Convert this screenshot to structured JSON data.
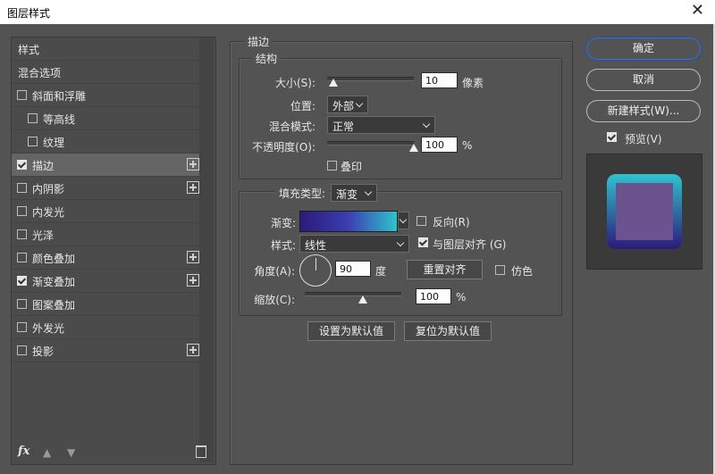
{
  "window": {
    "title": "图层样式",
    "close_icon": "close-icon"
  },
  "left_panel": {
    "items": [
      {
        "label": "样式",
        "checkbox": false,
        "checked": false,
        "plus": false,
        "indent": false,
        "selected": false
      },
      {
        "label": "混合选项",
        "checkbox": false,
        "checked": false,
        "plus": false,
        "indent": false,
        "selected": false
      },
      {
        "label": "斜面和浮雕",
        "checkbox": true,
        "checked": false,
        "plus": false,
        "indent": false,
        "selected": false
      },
      {
        "label": "等高线",
        "checkbox": true,
        "checked": false,
        "plus": false,
        "indent": true,
        "selected": false
      },
      {
        "label": "纹理",
        "checkbox": true,
        "checked": false,
        "plus": false,
        "indent": true,
        "selected": false
      },
      {
        "label": "描边",
        "checkbox": true,
        "checked": true,
        "plus": true,
        "indent": false,
        "selected": true
      },
      {
        "label": "内阴影",
        "checkbox": true,
        "checked": false,
        "plus": true,
        "indent": false,
        "selected": false
      },
      {
        "label": "内发光",
        "checkbox": true,
        "checked": false,
        "plus": false,
        "indent": false,
        "selected": false
      },
      {
        "label": "光泽",
        "checkbox": true,
        "checked": false,
        "plus": false,
        "indent": false,
        "selected": false
      },
      {
        "label": "颜色叠加",
        "checkbox": true,
        "checked": false,
        "plus": true,
        "indent": false,
        "selected": false
      },
      {
        "label": "渐变叠加",
        "checkbox": true,
        "checked": true,
        "plus": true,
        "indent": false,
        "selected": false
      },
      {
        "label": "图案叠加",
        "checkbox": true,
        "checked": false,
        "plus": false,
        "indent": false,
        "selected": false
      },
      {
        "label": "外发光",
        "checkbox": true,
        "checked": false,
        "plus": false,
        "indent": false,
        "selected": false
      },
      {
        "label": "投影",
        "checkbox": true,
        "checked": false,
        "plus": true,
        "indent": false,
        "selected": false
      }
    ],
    "fx_label": "fx"
  },
  "stroke": {
    "section_title": "描边",
    "structure": {
      "title": "结构",
      "size_label": "大小(S):",
      "size_value": "10",
      "size_unit": "像素",
      "size_level": 0.07,
      "position_label": "位置:",
      "position_value": "外部",
      "blend_label": "混合模式:",
      "blend_value": "正常",
      "opacity_label": "不透明度(O):",
      "opacity_value": "100",
      "opacity_unit": "%",
      "opacity_level": 1.0,
      "overprint_label": "叠印"
    },
    "fill": {
      "type_label": "填充类型:",
      "type_value": "渐变",
      "gradient_label": "渐变:",
      "gradient_colors": [
        "#2b1a7a",
        "#3a3fb0",
        "#2fc3cf"
      ],
      "reverse_label": "反向(R)",
      "style_label": "样式:",
      "style_value": "线性",
      "align_label": "与图层对齐 (G)",
      "angle_label": "角度(A):",
      "angle_value": "90",
      "angle_unit": "度",
      "reset_align_label": "重置对齐",
      "dither_label": "仿色",
      "scale_label": "缩放(C):",
      "scale_value": "100",
      "scale_unit": "%",
      "scale_level": 0.6
    }
  },
  "buttons": {
    "set_default": "设置为默认值",
    "reset_default": "复位为默认值"
  },
  "right": {
    "ok": "确定",
    "cancel": "取消",
    "new_style": "新建样式(W)...",
    "preview_label": "预览(V)"
  },
  "colors": {
    "preview_top": "#2fc3cf",
    "preview_bottom": "#2b1a7a",
    "preview_inner": "#6b5390",
    "accent": "#3a6fd8"
  }
}
